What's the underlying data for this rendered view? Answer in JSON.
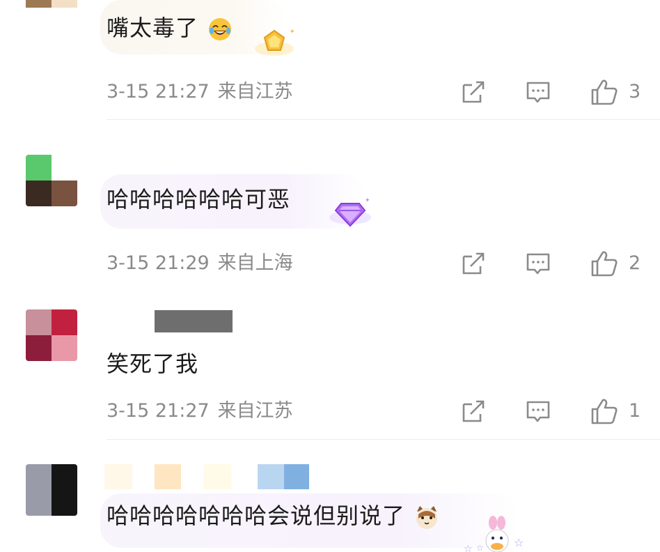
{
  "comments": [
    {
      "text": "嘴太毒了",
      "emoji": "laughing-tears-emoji",
      "time": "3-15 21:27",
      "location": "来自江苏",
      "likes": "3",
      "badge": "gold-pentagon-badge",
      "avatar_colors": [
        "#9b7a55",
        "#f3dfc6",
        "#ffffff",
        "#ffffff"
      ]
    },
    {
      "text": "哈哈哈哈哈哈可恶",
      "time": "3-15 21:29",
      "location": "来自上海",
      "likes": "2",
      "badge": "purple-diamond-badge",
      "avatar_colors": [
        "#5ac86c",
        "#ffffff",
        "#3a2a22",
        "#7a5240"
      ]
    },
    {
      "text": "笑死了我",
      "time": "3-15 21:27",
      "location": "来自江苏",
      "likes": "1",
      "avatar_colors": [
        "#c7909a",
        "#c1213f",
        "#8c1d3b",
        "#e998a8"
      ]
    },
    {
      "text": "哈哈哈哈哈哈哈会说但别说了",
      "emoji": "cat-face-emoji",
      "badge": "duck-sticker-badge",
      "avatar_colors": [
        "#9a9ba8",
        "#151515",
        "#9a9ba8",
        "#151515"
      ]
    }
  ],
  "icons": {
    "share": "share-icon",
    "reply": "comment-icon",
    "like": "thumbs-up-icon"
  },
  "colors": {
    "meta_text": "#8a8a8a",
    "icon_stroke": "#8a8a8a",
    "divider": "#ececec"
  }
}
